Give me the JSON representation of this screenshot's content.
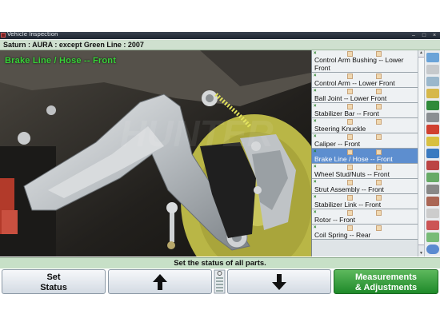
{
  "window": {
    "title": "Vehicle Inspection"
  },
  "vehicle": {
    "label": "Saturn : AURA : except Green Line : 2007"
  },
  "photo": {
    "caption": "Brake Line / Hose -- Front"
  },
  "parts": [
    {
      "label": "Control Arm Bushing -- Lower Front",
      "selected": false
    },
    {
      "label": "Control Arm -- Lower Front",
      "selected": false
    },
    {
      "label": "Ball Joint -- Lower Front",
      "selected": false
    },
    {
      "label": "Stabilizer Bar -- Front",
      "selected": false
    },
    {
      "label": "Steering Knuckle",
      "selected": false
    },
    {
      "label": "Caliper -- Front",
      "selected": false
    },
    {
      "label": "Brake Line / Hose -- Front",
      "selected": true
    },
    {
      "label": "Wheel Stud/Nuts -- Front",
      "selected": false
    },
    {
      "label": "Strut Assembly -- Front",
      "selected": false
    },
    {
      "label": "Stabilizer Link -- Front",
      "selected": false
    },
    {
      "label": "Rotor -- Front",
      "selected": false
    },
    {
      "label": "Coil Spring -- Rear",
      "selected": false
    }
  ],
  "status": {
    "message": "Set the status of all parts."
  },
  "fkeys": {
    "set_status_line1": "Set",
    "set_status_line2": "Status",
    "measurements_line1": "Measurements",
    "measurements_line2": "& Adjustments"
  },
  "colors": {
    "selected": "#5d8ecf",
    "accent_green": "#1f8a2a",
    "caption": "#38d238"
  }
}
